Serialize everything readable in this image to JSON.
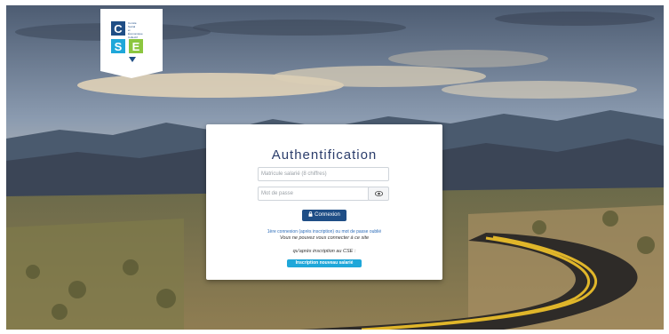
{
  "logo": {
    "letters": [
      "C",
      "S",
      "E"
    ],
    "text_lines": [
      "Comité",
      "Social",
      "et",
      "Économique",
      "Collectif"
    ]
  },
  "login": {
    "title": "Authentification",
    "matricule_placeholder": "Matricule salarié (8 chiffres)",
    "password_placeholder": "Mot de passe",
    "connexion_label": "Connexion",
    "first_connection_link": "1ère connexion (après inscription) ou mot de passe oublié",
    "info_line1": "Vous ne pouvez vous connecter à ce site",
    "info_line2": "qu'après inscription au CSE :",
    "register_label": "Inscription nouveau salarié"
  },
  "icons": {
    "eye": "eye-icon",
    "lock": "lock-icon"
  },
  "colors": {
    "brand_blue": "#1f4e86",
    "accent_cyan": "#1fa7d9",
    "logo_green": "#8cc63f",
    "title": "#2b3d6b"
  }
}
